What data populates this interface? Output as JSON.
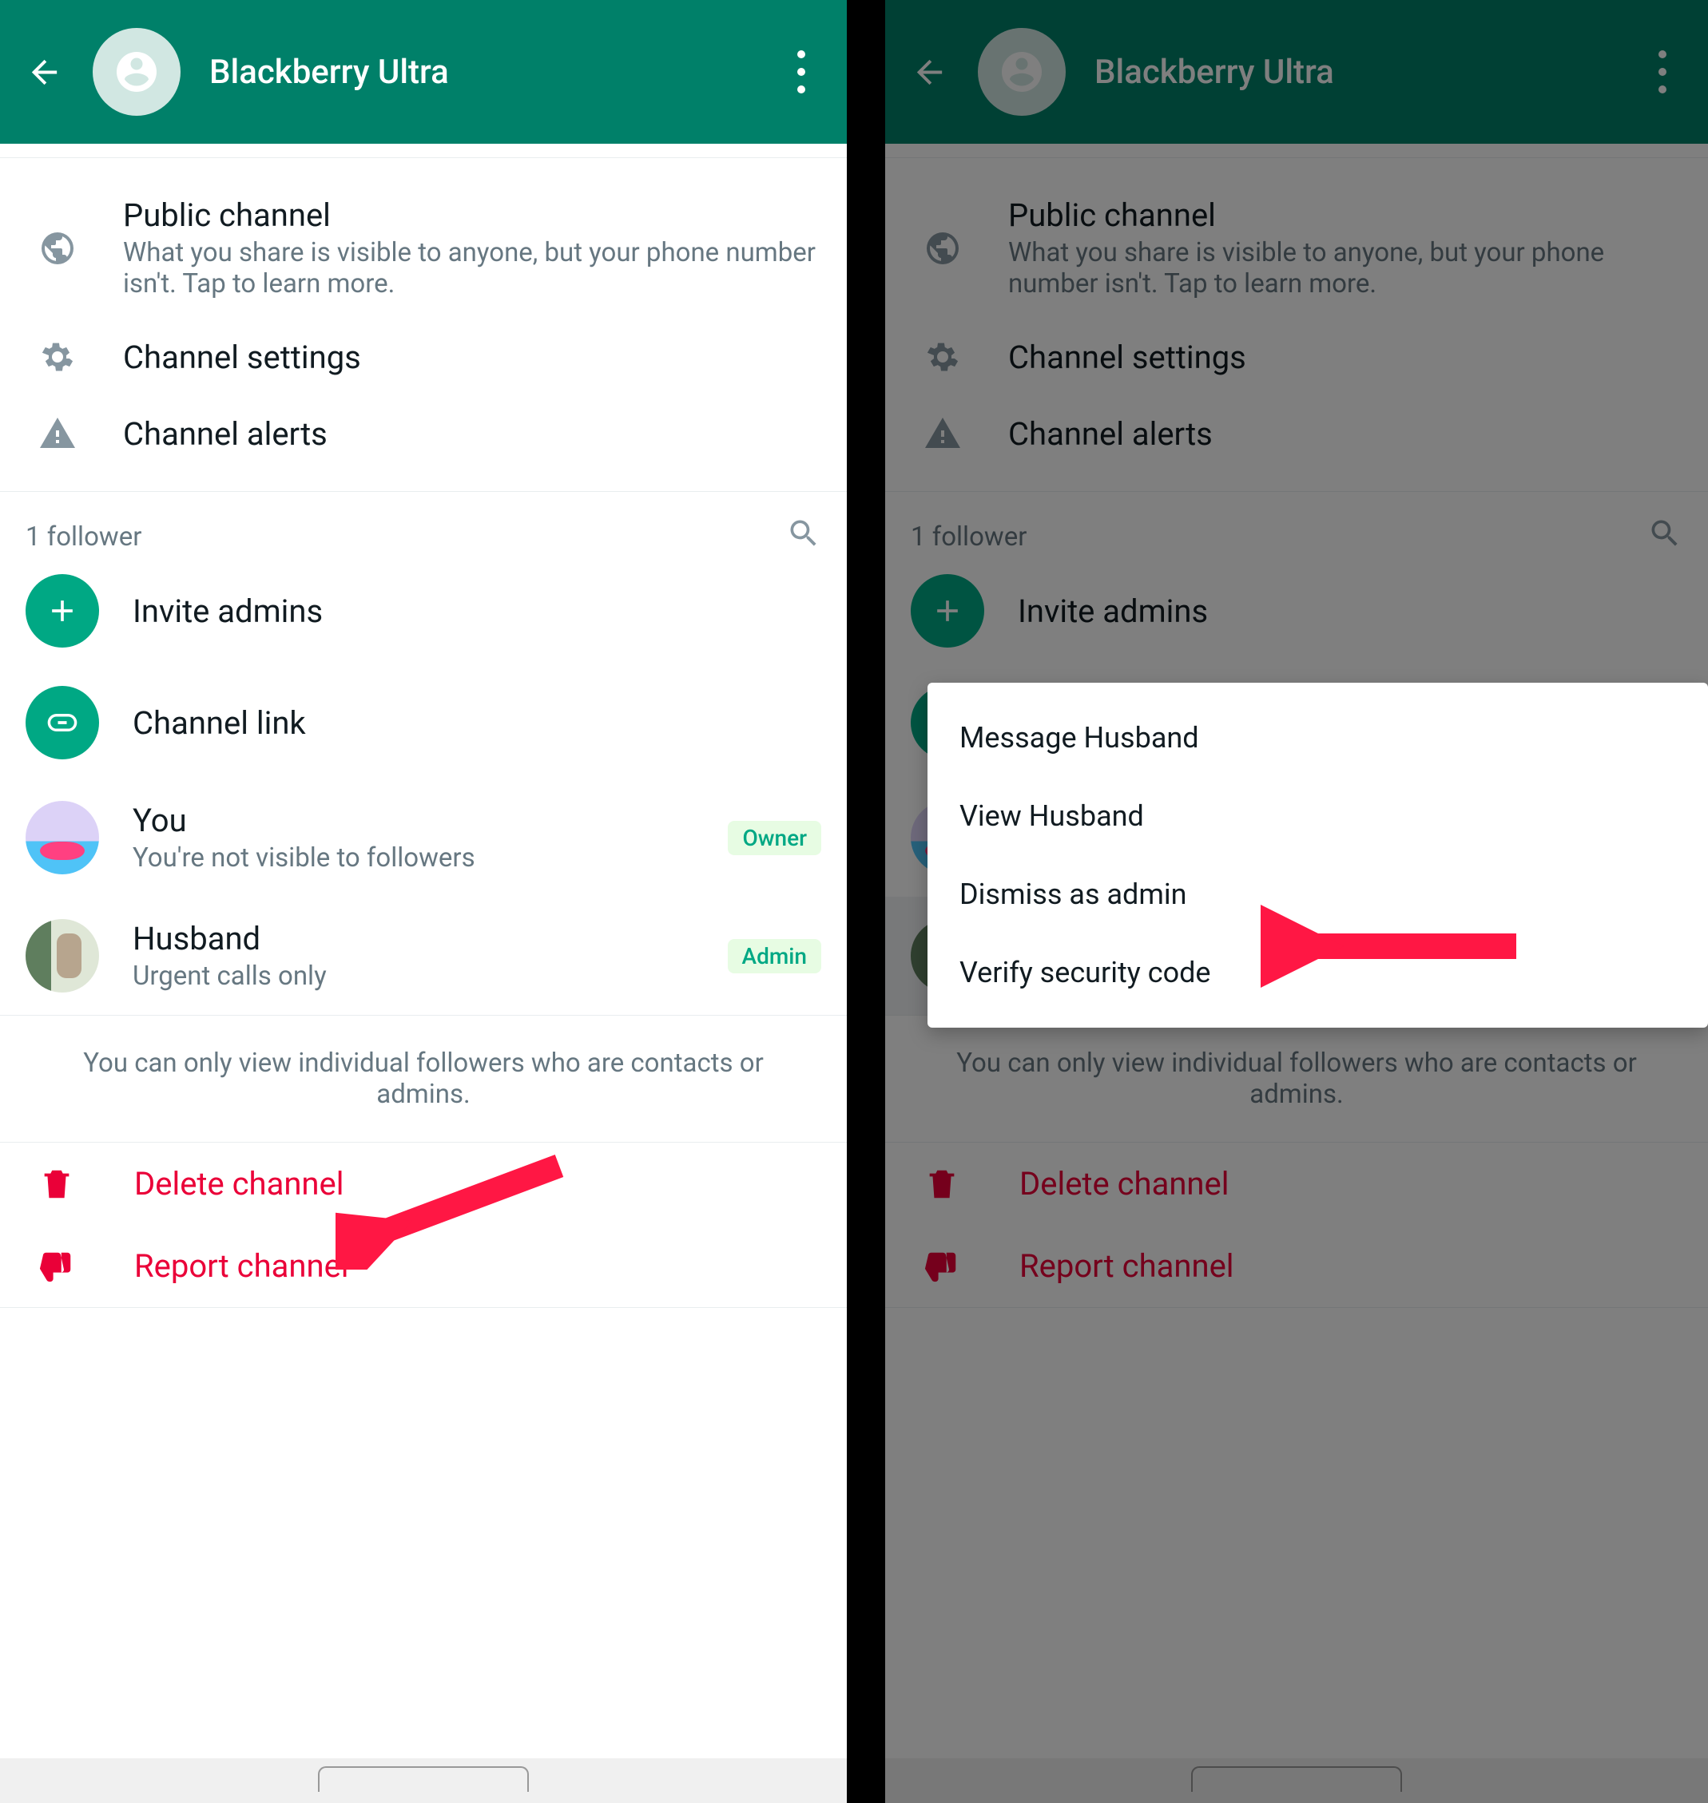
{
  "header": {
    "title": "Blackberry Ultra"
  },
  "info": {
    "public_title": "Public channel",
    "public_sub": "What you share is visible to anyone, but your phone number isn't. Tap to learn more.",
    "settings": "Channel settings",
    "alerts": "Channel alerts"
  },
  "followers": {
    "count_label": "1 follower",
    "invite": "Invite admins",
    "link": "Channel link"
  },
  "members": [
    {
      "name": "You",
      "status": "You're not visible to followers",
      "badge": "Owner"
    },
    {
      "name": "Husband",
      "status": "Urgent calls only",
      "badge": "Admin"
    }
  ],
  "note": "You can only view individual followers who are contacts or admins.",
  "danger": {
    "delete": "Delete channel",
    "report": "Report channel"
  },
  "popup": {
    "items": [
      "Message Husband",
      "View Husband",
      "Dismiss as admin",
      "Verify security code"
    ]
  }
}
